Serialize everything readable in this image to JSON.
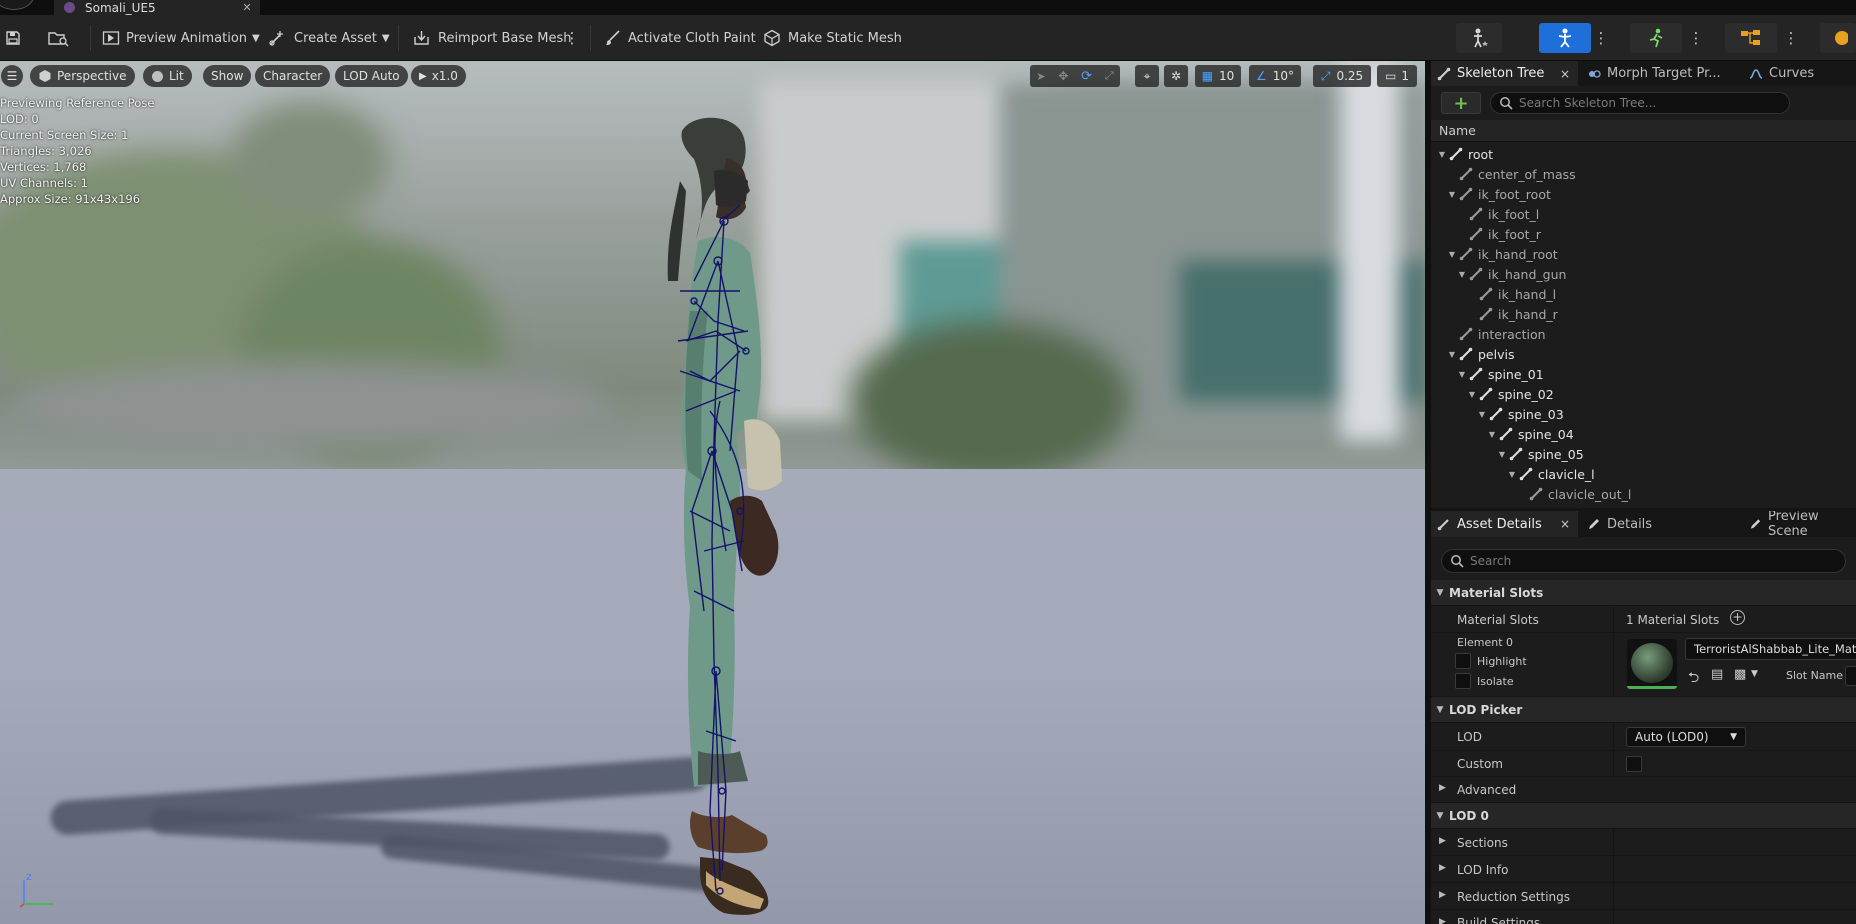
{
  "doc_tab": {
    "title": "Somali_UE5"
  },
  "toolbar": {
    "preview_animation": "Preview Animation",
    "create_asset": "Create Asset",
    "reimport_base_mesh": "Reimport Base Mesh",
    "activate_cloth_paint": "Activate Cloth Paint",
    "make_static_mesh": "Make Static Mesh",
    "accent_color": "#1e6fd9"
  },
  "viewport": {
    "perspective": "Perspective",
    "lit": "Lit",
    "show": "Show",
    "character": "Character",
    "lod_auto": "LOD Auto",
    "play_speed": "x1.0",
    "grid_size": "10",
    "rotation_snap": "10°",
    "scale_snap": "0.25",
    "camera_speed": "1",
    "stats": [
      "Previewing Reference Pose",
      "LOD: 0",
      "Current Screen Size: 1",
      "Triangles: 3,026",
      "Vertices: 1,768",
      "UV Channels: 1",
      "Approx Size: 91x43x196"
    ],
    "axis_z": "z"
  },
  "skeleton_panel": {
    "tabs": [
      {
        "label": "Skeleton Tree",
        "close": "×"
      },
      {
        "label": "Morph Target Pr..."
      },
      {
        "label": "Curves"
      }
    ],
    "add_label": "+",
    "search_placeholder": "Search Skeleton Tree...",
    "column_name": "Name",
    "bones": [
      {
        "name": "root",
        "depth": 0,
        "expanded": true,
        "bright": true
      },
      {
        "name": "center_of_mass",
        "depth": 1,
        "expanded": false,
        "bright": false
      },
      {
        "name": "ik_foot_root",
        "depth": 1,
        "expanded": true,
        "bright": false
      },
      {
        "name": "ik_foot_l",
        "depth": 2,
        "expanded": false,
        "bright": false
      },
      {
        "name": "ik_foot_r",
        "depth": 2,
        "expanded": false,
        "bright": false
      },
      {
        "name": "ik_hand_root",
        "depth": 1,
        "expanded": true,
        "bright": false
      },
      {
        "name": "ik_hand_gun",
        "depth": 2,
        "expanded": true,
        "bright": false
      },
      {
        "name": "ik_hand_l",
        "depth": 3,
        "expanded": false,
        "bright": false
      },
      {
        "name": "ik_hand_r",
        "depth": 3,
        "expanded": false,
        "bright": false
      },
      {
        "name": "interaction",
        "depth": 1,
        "expanded": false,
        "bright": false
      },
      {
        "name": "pelvis",
        "depth": 1,
        "expanded": true,
        "bright": true
      },
      {
        "name": "spine_01",
        "depth": 2,
        "expanded": true,
        "bright": true
      },
      {
        "name": "spine_02",
        "depth": 3,
        "expanded": true,
        "bright": true
      },
      {
        "name": "spine_03",
        "depth": 4,
        "expanded": true,
        "bright": true
      },
      {
        "name": "spine_04",
        "depth": 5,
        "expanded": true,
        "bright": true
      },
      {
        "name": "spine_05",
        "depth": 6,
        "expanded": true,
        "bright": true
      },
      {
        "name": "clavicle_l",
        "depth": 7,
        "expanded": true,
        "bright": true
      },
      {
        "name": "clavicle_out_l",
        "depth": 8,
        "expanded": false,
        "bright": false
      }
    ]
  },
  "details_panel": {
    "tabs": [
      {
        "label": "Asset Details",
        "close": "×"
      },
      {
        "label": "Details"
      },
      {
        "label": "Preview Scene"
      }
    ],
    "search_placeholder": "Search",
    "material_slots_section": "Material Slots",
    "material_slots_label": "Material Slots",
    "material_slots_value": "1 Material Slots",
    "element_label": "Element 0",
    "highlight_label": "Highlight",
    "isolate_label": "Isolate",
    "material_name": "TerroristAlShabbab_Lite_Mat_Inst",
    "slot_name_label": "Slot Name",
    "lod_picker_section": "LOD Picker",
    "lod_label": "LOD",
    "lod_value": "Auto (LOD0)",
    "custom_label": "Custom",
    "advanced_label": "Advanced",
    "lod0_section": "LOD 0",
    "sections_label": "Sections",
    "lod_info_label": "LOD Info",
    "reduction_settings_label": "Reduction Settings",
    "build_settings_label": "Build Settings"
  }
}
